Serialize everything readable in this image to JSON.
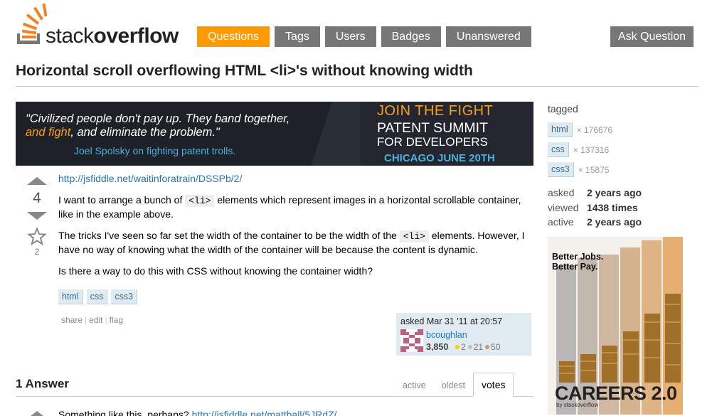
{
  "header": {
    "logo_light": "stack",
    "logo_bold": "overflow",
    "nav": [
      {
        "label": "Questions",
        "active": true
      },
      {
        "label": "Tags",
        "active": false
      },
      {
        "label": "Users",
        "active": false
      },
      {
        "label": "Badges",
        "active": false
      },
      {
        "label": "Unanswered",
        "active": false
      }
    ],
    "ask_label": "Ask Question"
  },
  "question": {
    "title": "Horizontal scroll overflowing HTML <li>'s without knowing width",
    "votes": "4",
    "favorites": "2",
    "link": "http://jsfiddle.net/waitinforatrain/DSSPb/2/",
    "p1_before": "I want to arrange a bunch of ",
    "p1_code": "<li>",
    "p1_after": " elements which represent images in a horizontal scrollable container, like in the example above.",
    "p2_before": "The tricks I've seen so far set the width of the container to be the width of the ",
    "p2_code": "<li>",
    "p2_after": " elements. However, I have no way of knowing what the width of the container will be because the content is dynamic.",
    "p3": "Is there a way to do this with CSS without knowing the container width?",
    "tags": [
      "html",
      "css",
      "css3"
    ],
    "menu": {
      "share": "share",
      "edit": "edit",
      "flag": "flag"
    },
    "owner": {
      "asked": "asked Mar 31 '11 at 20:57",
      "name": "bcoughlan",
      "rep": "3,850",
      "gold": "2",
      "silver": "21",
      "bronze": "50"
    }
  },
  "banner": {
    "quote_1": "\"Civilized people don't pay up. They band together,",
    "quote_2_highlight": "and fight",
    "quote_2_rest": ", and eliminate the problem.\"",
    "attribution": "Joel Spolsky on fighting patent trolls.",
    "join": "JOIN THE FIGHT",
    "patent": "PATENT SUMMIT",
    "fordev": "FOR DEVELOPERS",
    "chicago": "CHICAGO  JUNE 20TH"
  },
  "answers": {
    "title": "1 Answer",
    "tabs": [
      {
        "label": "active",
        "selected": false
      },
      {
        "label": "oldest",
        "selected": false
      },
      {
        "label": "votes",
        "selected": true
      }
    ],
    "snippet": "Something like this, perhaps? ",
    "snippet_link": "http://jsfiddle.net/mattball/5JRdZ/"
  },
  "sidebar": {
    "tagged_label": "tagged",
    "tags": [
      {
        "name": "html",
        "count": "× 176676"
      },
      {
        "name": "css",
        "count": "× 137316"
      },
      {
        "name": "css3",
        "count": "× 15875"
      }
    ],
    "stats": [
      {
        "label": "asked",
        "value": "2 years ago"
      },
      {
        "label": "viewed",
        "value": "1438 times"
      },
      {
        "label": "active",
        "value": "2 years ago"
      }
    ],
    "careers": {
      "line1": "Better Jobs.",
      "line2": "Better Pay.",
      "brand": "CAREERS 2.0",
      "by": "by stackoverflow"
    }
  },
  "colors": {
    "accent": "#ff9900",
    "nav_gray": "#777777",
    "link": "#2277bb",
    "tag_bg": "#e0eaf1"
  }
}
